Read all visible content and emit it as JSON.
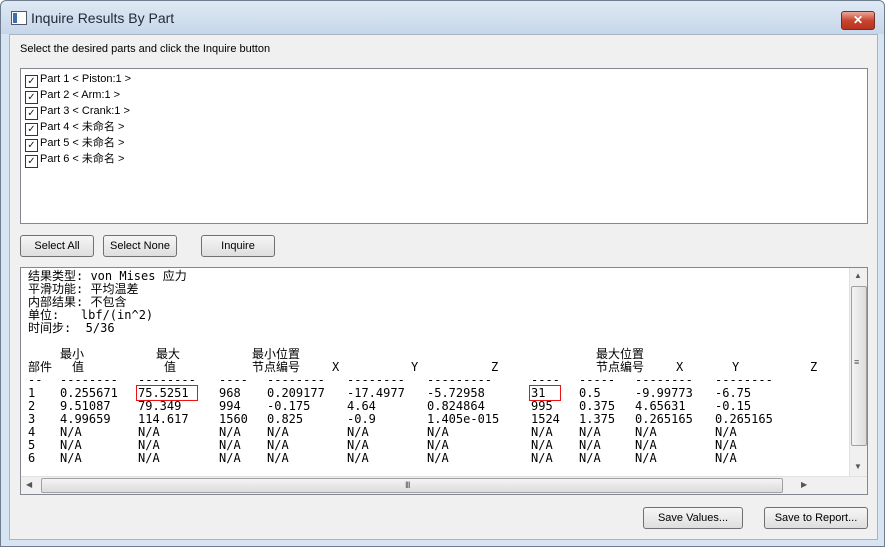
{
  "window": {
    "title": "Inquire Results By Part",
    "close_glyph": "✕"
  },
  "instruction": "Select the desired parts and click the Inquire button",
  "parts": [
    {
      "label": "Part 1 < Piston:1 >",
      "checked": true
    },
    {
      "label": "Part 2 < Arm:1 >",
      "checked": true
    },
    {
      "label": "Part 3 < Crank:1 >",
      "checked": true
    },
    {
      "label": "Part 4 < 未命名 >",
      "checked": true
    },
    {
      "label": "Part 5 < 未命名 >",
      "checked": true
    },
    {
      "label": "Part 6 < 未命名 >",
      "checked": true
    }
  ],
  "buttons": {
    "select_all": "Select All",
    "select_none": "Select None",
    "inquire": "Inquire",
    "save_values": "Save Values...",
    "save_report": "Save to Report..."
  },
  "summary": [
    "结果类型: von Mises 应力",
    "平滑功能: 平均温差",
    "内部结果: 不包含",
    "单位:   lbf/(in^2)",
    "时间步:  5/36"
  ],
  "table": {
    "header_top": [
      "最小",
      "最大",
      "最小位置",
      "最大位置"
    ],
    "header_bottom": [
      "部件",
      "值",
      "值",
      "节点编号",
      "X",
      "Y",
      "Z",
      "节点编号",
      "X",
      "Y",
      "Z"
    ],
    "dashes": [
      "--",
      "--------",
      "--------",
      "----",
      "--------",
      "--------",
      "---------",
      "----",
      "-----",
      "--------",
      "--------"
    ],
    "rows": [
      [
        "1",
        "0.255671",
        "75.5251",
        "968",
        "0.209177",
        "-17.4977",
        "-5.72958",
        "31",
        "0.5",
        "-9.99773",
        "-6.75"
      ],
      [
        "2",
        "9.51087",
        "79.349",
        "994",
        "-0.175",
        "4.64",
        "0.824864",
        "995",
        "0.375",
        "4.65631",
        "-0.15"
      ],
      [
        "3",
        "4.99659",
        "114.617",
        "1560",
        "0.825",
        "-0.9",
        "1.405e-015",
        "1524",
        "1.375",
        "0.265165",
        "0.265165"
      ],
      [
        "4",
        "N/A",
        "N/A",
        "N/A",
        "N/A",
        "N/A",
        "N/A",
        "N/A",
        "N/A",
        "N/A",
        "N/A"
      ],
      [
        "5",
        "N/A",
        "N/A",
        "N/A",
        "N/A",
        "N/A",
        "N/A",
        "N/A",
        "N/A",
        "N/A",
        "N/A"
      ],
      [
        "6",
        "N/A",
        "N/A",
        "N/A",
        "N/A",
        "N/A",
        "N/A",
        "N/A",
        "N/A",
        "N/A",
        "N/A"
      ]
    ],
    "highlighted": [
      {
        "row": 0,
        "col": 2
      },
      {
        "row": 0,
        "col": 7
      }
    ]
  },
  "scrollbar": {
    "h_grip": "III",
    "v_grip": "≡"
  },
  "colors": {
    "highlight": "#ee1111",
    "title_bar": "#c6d6ea",
    "close_button": "#c9452f"
  }
}
